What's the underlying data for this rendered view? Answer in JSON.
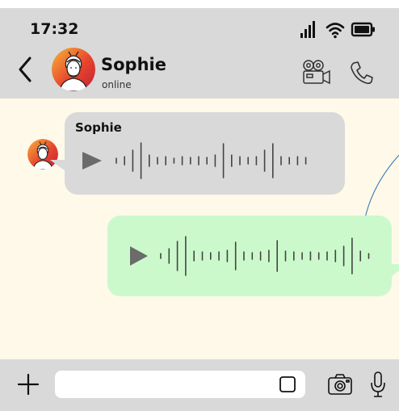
{
  "status_bar": {
    "time": "17:32",
    "icons": [
      "signal-icon",
      "wifi-icon",
      "battery-icon"
    ]
  },
  "header": {
    "contact_name": "Sophie",
    "contact_status": "online",
    "icons": [
      "back-icon",
      "avatar",
      "video-call-icon",
      "phone-call-icon"
    ]
  },
  "messages": [
    {
      "direction": "incoming",
      "sender": "Sophie",
      "type": "voice",
      "icons": [
        "play-icon",
        "waveform-icon"
      ]
    },
    {
      "direction": "outgoing",
      "type": "voice",
      "icons": [
        "play-icon",
        "waveform-icon"
      ]
    }
  ],
  "input_bar": {
    "text": "",
    "placeholder": "",
    "icons": [
      "plus-icon",
      "sticker-icon",
      "camera-icon",
      "microphone-icon"
    ]
  },
  "colors": {
    "frame": "#d9d9d9",
    "chat_background": "#fef9e8",
    "incoming_bubble": "#d9d9d9",
    "outgoing_bubble": "#ccf9cc",
    "play_icon": "#6b6b6b",
    "decorative_curve": "#2a6fb0",
    "avatar_gradient": [
      "#f6b73c",
      "#e8452c",
      "#c21f3a"
    ]
  }
}
